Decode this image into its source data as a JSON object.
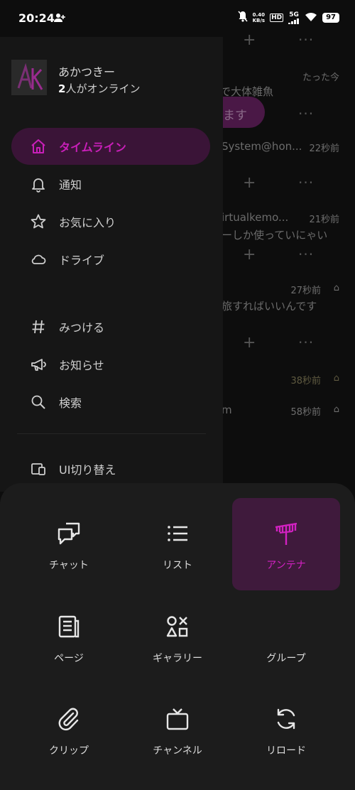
{
  "status_bar": {
    "time": "20:24",
    "net_speed_value": "0.40",
    "net_speed_unit": "KB/s",
    "hd": "HD",
    "network": "5G",
    "battery": "97"
  },
  "user": {
    "display_name": "あかつきー",
    "online_count": "2",
    "online_suffix": "人がオンライン"
  },
  "drawer": {
    "items": [
      {
        "label": "タイムライン",
        "icon": "home-icon",
        "active": true
      },
      {
        "label": "通知",
        "icon": "bell-icon"
      },
      {
        "label": "お気に入り",
        "icon": "star-icon"
      },
      {
        "label": "ドライブ",
        "icon": "cloud-icon"
      },
      {
        "label": "みつける",
        "icon": "hash-icon"
      },
      {
        "label": "お知らせ",
        "icon": "megaphone-icon"
      },
      {
        "label": "検索",
        "icon": "search-icon"
      },
      {
        "label": "UI切り替え",
        "icon": "devices-icon"
      }
    ]
  },
  "background_timeline": {
    "partial_text_1": "たった今",
    "partial_text_2": "で大体雑魚",
    "partial_button": "ます",
    "row1_name": "System@hon...",
    "row1_time": "22秒前",
    "row2_name": "irtualkemo...",
    "row2_time": "21秒前",
    "row2_text": "ーしか使っていにゃい",
    "row3_time": "27秒前",
    "row3_text": "旅すればいいんです",
    "row4_time": "38秒前",
    "row5_name": "m",
    "row5_time": "58秒前"
  },
  "menu": {
    "items": [
      {
        "label": "チャット",
        "icon": "chat-icon"
      },
      {
        "label": "リスト",
        "icon": "list-icon"
      },
      {
        "label": "アンテナ",
        "icon": "antenna-icon",
        "active": true
      },
      {
        "label": "ページ",
        "icon": "page-icon"
      },
      {
        "label": "ギャラリー",
        "icon": "gallery-icon"
      },
      {
        "label": "グループ",
        "icon": "group-icon"
      },
      {
        "label": "クリップ",
        "icon": "paperclip-icon"
      },
      {
        "label": "チャンネル",
        "icon": "tv-icon"
      },
      {
        "label": "リロード",
        "icon": "reload-icon"
      }
    ]
  },
  "colors": {
    "accent": "#c81fb8",
    "accent_bg": "#3f1a3c",
    "drawer_bg": "#161616",
    "sheet_bg": "#1c1c1c"
  }
}
